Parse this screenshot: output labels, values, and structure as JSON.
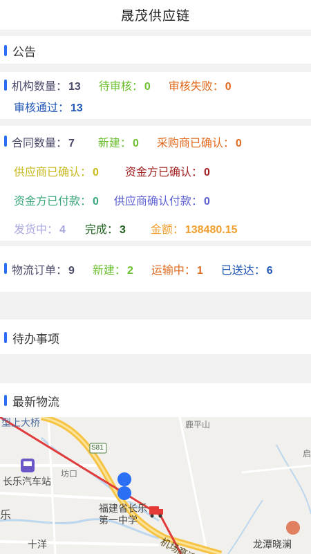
{
  "header": {
    "title": "晟茂供应链"
  },
  "notice": {
    "title": "公告"
  },
  "org": {
    "stats": [
      {
        "label": "机构数量：",
        "value": "13",
        "color": "#4a4a6a"
      },
      {
        "label": "待审核：",
        "value": "0",
        "color": "#6cbf2f"
      },
      {
        "label": "审核失败：",
        "value": "0",
        "color": "#e06a1e"
      },
      {
        "label": "审核通过：",
        "value": "13",
        "color": "#1f55b5"
      }
    ]
  },
  "contract": {
    "stats": [
      {
        "label": "合同数量：",
        "value": "7",
        "color": "#4a4a6a"
      },
      {
        "label": "新建：",
        "value": "0",
        "color": "#6cbf2f"
      },
      {
        "label": "采购商已确认：",
        "value": "0",
        "color": "#e06a1e"
      },
      {
        "label": "供应商已确认：",
        "value": "0",
        "color": "#c7b91e"
      },
      {
        "label": "资金方已确认：",
        "value": "0",
        "color": "#a21f1f"
      },
      {
        "label": "资金方已付款：",
        "value": "0",
        "color": "#3aa67a"
      },
      {
        "label": "供应商确认付款：",
        "value": "0",
        "color": "#5b5fd1"
      },
      {
        "label": "发货中：",
        "value": "4",
        "color": "#a9a9e0"
      },
      {
        "label": "完成：",
        "value": "3",
        "color": "#1e5e1e"
      },
      {
        "label": "金额：",
        "value": "138480.15",
        "color": "#f0a030"
      }
    ]
  },
  "logistics": {
    "stats": [
      {
        "label": "物流订单：",
        "value": "9",
        "color": "#4a4a6a"
      },
      {
        "label": "新建：",
        "value": "2",
        "color": "#6cbf2f"
      },
      {
        "label": "运输中：",
        "value": "1",
        "color": "#e06a1e"
      },
      {
        "label": "已送达：",
        "value": "6",
        "color": "#1f55b5"
      }
    ]
  },
  "todo": {
    "title": "待办事项"
  },
  "latest": {
    "title": "最新物流"
  },
  "map": {
    "labels": {
      "bridge": "型上大桥",
      "mountain": "鹿平山",
      "highway": "S81",
      "bus_station": "长乐汽车站",
      "fangkou": "坊口",
      "le": "乐",
      "school": "福建省长乐第一中学",
      "shiyang": "十洋",
      "longtan": "龙潭晓澜",
      "airport_road": "机场高速",
      "ri": "启"
    },
    "road_color": "#f6c344",
    "route_color": "#e23b3b"
  }
}
